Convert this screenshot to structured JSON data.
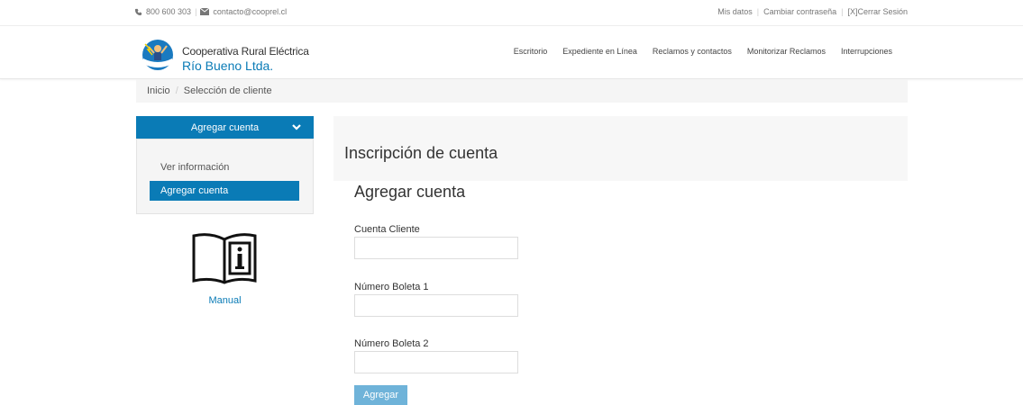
{
  "topbar": {
    "phone": "800 600 303",
    "email": "contacto@cooprel.cl",
    "links": [
      "Mis datos",
      "Cambiar contraseña",
      "[X]Cerrar Sesión"
    ]
  },
  "brand": {
    "line1": "Cooperativa Rural Eléctrica",
    "line2": "Río Bueno Ltda."
  },
  "nav": {
    "items": [
      "Escritorio",
      "Expediente en Línea",
      "Reclamos y contactos",
      "Monitorizar Reclamos",
      "Interrupciones"
    ]
  },
  "breadcrumb": {
    "home": "Inicio",
    "current": "Selección de cliente"
  },
  "sidebar": {
    "header": "Agregar cuenta",
    "items": [
      "Ver información",
      "Agregar cuenta"
    ],
    "manual_label": "Manual"
  },
  "main": {
    "panel_title": "Inscripción de cuenta",
    "form_title": "Agregar cuenta",
    "fields": [
      {
        "label": "Cuenta Cliente",
        "value": ""
      },
      {
        "label": "Número Boleta 1",
        "value": ""
      },
      {
        "label": "Número Boleta 2",
        "value": ""
      }
    ],
    "submit_label": "Agregar"
  },
  "colors": {
    "accent": "#0a7bb6",
    "button": "#6fb3d9"
  }
}
